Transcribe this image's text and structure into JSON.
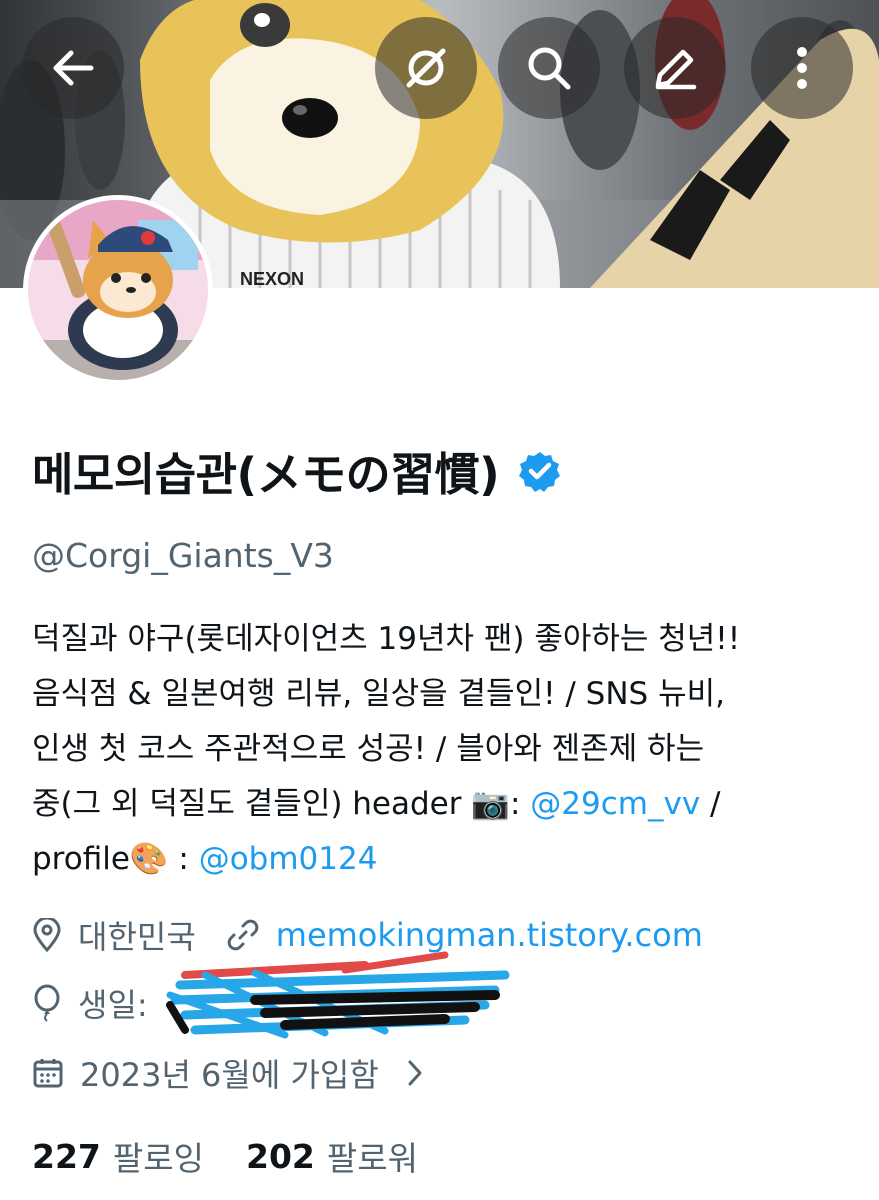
{
  "header": {
    "banner_description_icon": "mascot-photo",
    "buttons": [
      {
        "name": "back-button",
        "icon": "arrow-left-icon"
      },
      {
        "name": "hide-media-button",
        "icon": "eye-slash-icon"
      },
      {
        "name": "search-button",
        "icon": "search-icon"
      },
      {
        "name": "edit-button",
        "icon": "pencil-icon"
      },
      {
        "name": "more-button",
        "icon": "more-vertical-icon"
      }
    ]
  },
  "profile": {
    "display_name": "메모의습관(メモの習慣)",
    "verified": true,
    "handle": "@Corgi_Giants_V3",
    "bio": {
      "line1": "덕질과 야구(롯데자이언츠 19년차 팬) 좋아하는 청년!!",
      "line2": "음식점 & 일본여행 리뷰, 일상을 곁들인!  / SNS 뉴비,",
      "line3": "인생 첫 코스 주관적으로 성공! / 블아와 젠존제 하는",
      "line4_pre": "중(그 외 덕질도 곁들인)  header ",
      "line4_emoji": "📷",
      "line4_colon": ": ",
      "line4_mention": "@29cm_vv",
      "line4_post": "  /",
      "line5_pre": "profile",
      "line5_emoji": "🎨",
      "line5_colon": "  : ",
      "line5_mention": "@obm0124"
    },
    "location": "대한민국",
    "website": "memokingman.tistory.com",
    "birthday_label": "생일:",
    "joined": "2023년 6월에 가입함",
    "following_count": "227",
    "following_label": "팔로잉",
    "followers_count": "202",
    "followers_label": "팔로워"
  },
  "colors": {
    "accent": "#1d9bf0",
    "secondary_text": "#536471",
    "primary_text": "#0f1419"
  }
}
